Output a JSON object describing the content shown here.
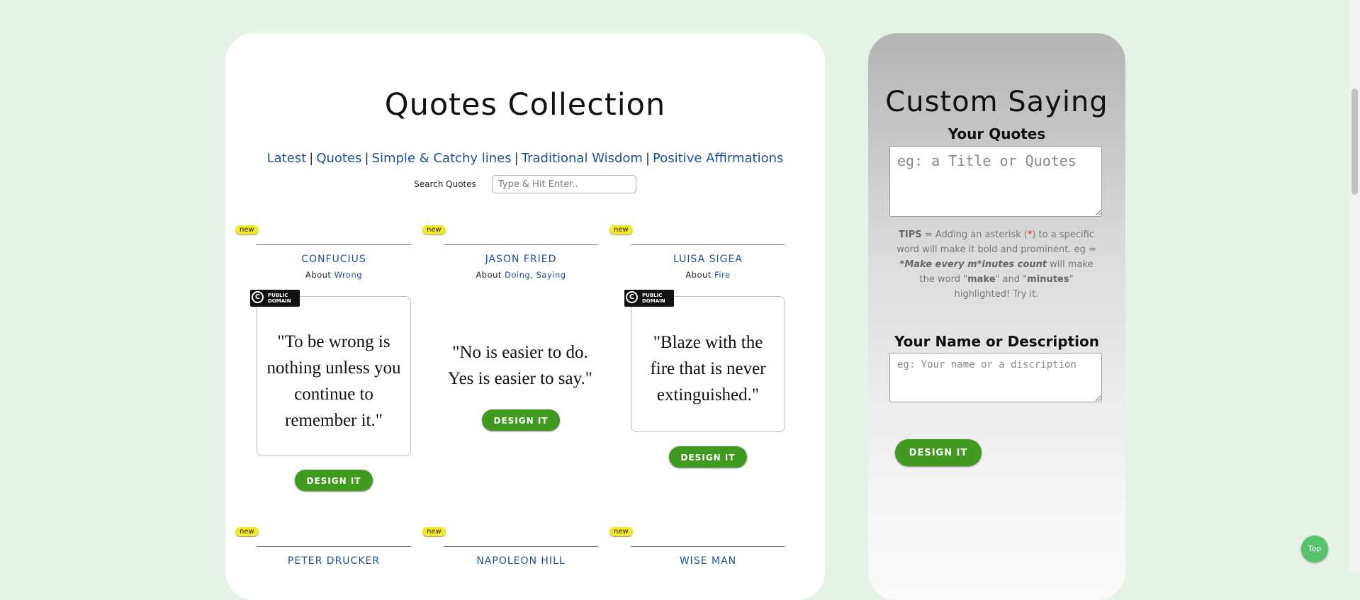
{
  "main": {
    "title": "Quotes Collection",
    "nav": [
      "Latest",
      "Quotes",
      "Simple & Catchy lines",
      "Traditional Wisdom",
      "Positive Affirmations"
    ],
    "nav_separator": "|",
    "search": {
      "label": "Search Quotes",
      "placeholder": "Type & Hit Enter.."
    }
  },
  "quotes": [
    {
      "badge": "new",
      "author": "CONFUCIUS",
      "about_prefix": "About",
      "topics": [
        "Wrong"
      ],
      "public_domain": true,
      "pd_text": "PUBLIC DOMAIN",
      "text": "\"To be wrong is nothing unless you continue to remember it.\"",
      "button": "DESIGN IT"
    },
    {
      "badge": "new",
      "author": "JASON FRIED",
      "about_prefix": "About",
      "topics": [
        "Doing",
        "Saying"
      ],
      "public_domain": false,
      "text": "\"No is easier to do. Yes is easier to say.\"",
      "button": "DESIGN IT"
    },
    {
      "badge": "new",
      "author": "LUISA SIGEA",
      "about_prefix": "About",
      "topics": [
        "Fire"
      ],
      "public_domain": true,
      "pd_text": "PUBLIC DOMAIN",
      "text": "\"Blaze with the fire that is never extinguished.\"",
      "button": "DESIGN IT"
    },
    {
      "badge": "new",
      "author": "PETER DRUCKER"
    },
    {
      "badge": "new",
      "author": "NAPOLEON HILL"
    },
    {
      "badge": "new",
      "author": "WISE MAN"
    }
  ],
  "sidebar": {
    "title": "Custom Saying",
    "quote_label": "Your Quotes",
    "quote_placeholder": "eg: a Title or Quotes",
    "tips": {
      "label": "TIPS",
      "part1": " = Adding an asterisk (",
      "star": "*",
      "part2": ") to a specific word will make it bold and prominent. eg = ",
      "example": "*Make every m*inutes count",
      "part3": " will make the word \"",
      "word1": "make",
      "part4": "\" and \"",
      "word2": "minutes",
      "part5": "\" highlighted! Try it."
    },
    "name_label": "Your Name or Description",
    "name_placeholder": "eg: Your name or a discription",
    "button": "DESIGN IT"
  },
  "top_button": "Top"
}
